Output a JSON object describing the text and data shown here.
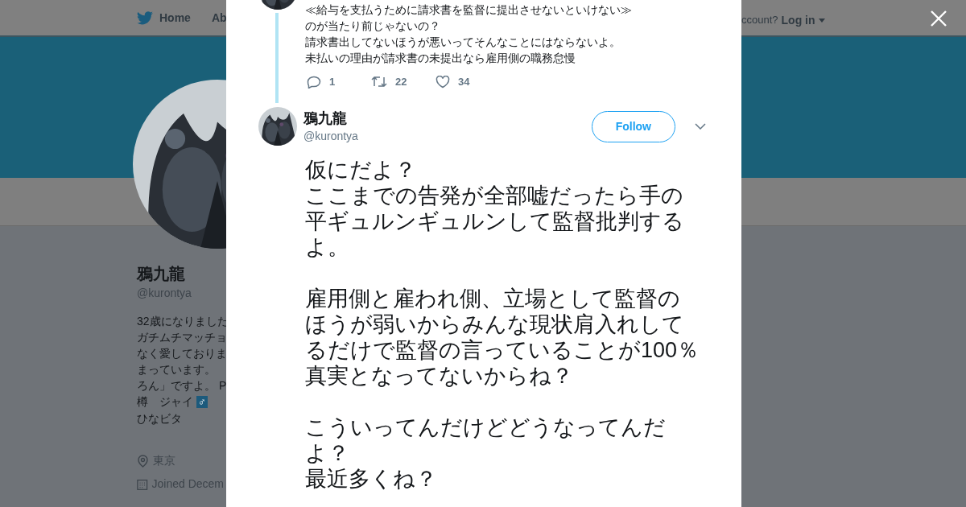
{
  "nav": {
    "home": "Home",
    "about": "Ab",
    "account_prompt": "ccount?",
    "login": "Log in"
  },
  "profile": {
    "name": "鴉九龍",
    "handle": "@kurontya",
    "bio_lines": [
      {
        "text": "32歳になりました"
      },
      {
        "text": "ガチムチマッチョ"
      },
      {
        "text": "なく愛しておりま"
      },
      {
        "text": "まっています。"
      },
      {
        "text": "ろん」ですよ。 P"
      },
      {
        "text": "樽　ジャイ",
        "badge": "♂"
      },
      {
        "text": "ひなビタ"
      }
    ],
    "location": "東京",
    "joined": "Joined Decem"
  },
  "previous_tweet": {
    "lines": [
      "≪給与を支払うために請求書を監督に提出させないといけない≫",
      "のが当たり前じゃないの？",
      "請求書出してないほうが悪いってそんなことにはならないよ。",
      "未払いの理由が請求書の未提出なら雇用側の職務怠慢"
    ],
    "actions": [
      {
        "kind": "reply",
        "count": "1"
      },
      {
        "kind": "retweet",
        "count": "22"
      },
      {
        "kind": "like",
        "count": "34"
      }
    ]
  },
  "tweet": {
    "name": "鴉九龍",
    "handle": "@kurontya",
    "follow": "Follow",
    "paragraphs": [
      [
        "仮にだよ？",
        "ここまでの告発が全部嘘だったら手の平ギュルンギュルンして監督批判するよ。"
      ],
      [
        "雇用側と雇われ側、立場として監督のほうが弱いからみんな現状肩入れしてるだけで監督の言っていることが100％真実となってないからね？"
      ],
      [
        "こういってんだけどどうなってんだよ？",
        "最近多くね？"
      ]
    ]
  }
}
